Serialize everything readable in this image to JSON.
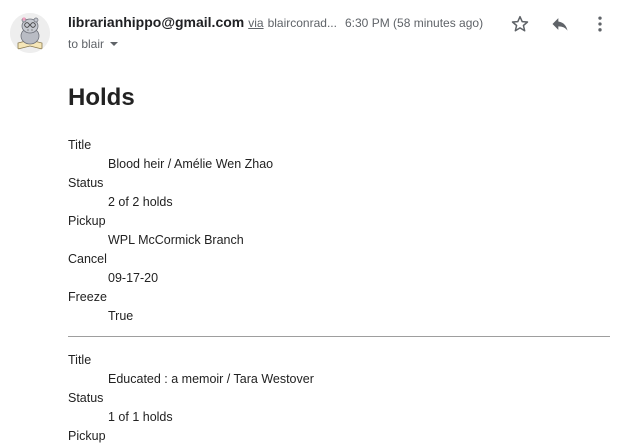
{
  "header": {
    "sender_email": "librarianhippo@gmail.com",
    "via_label": "via",
    "via_address": "blairconrad...",
    "time": "6:30 PM (58 minutes ago)",
    "to_text": "to blair"
  },
  "icons": {
    "avatar": "hippo-avatar",
    "star": "star-icon",
    "reply": "reply-icon",
    "more": "more-vert-icon",
    "caret": "caret-down-icon"
  },
  "page_title": "Holds",
  "holds": [
    {
      "title_label": "Title",
      "title_value": "Blood heir / Amélie Wen Zhao",
      "status_label": "Status",
      "status_value": "2 of 2 holds",
      "pickup_label": "Pickup",
      "pickup_value": "WPL McCormick Branch",
      "cancel_label": "Cancel",
      "cancel_value": "09-17-20",
      "freeze_label": "Freeze",
      "freeze_value": "True"
    },
    {
      "title_label": "Title",
      "title_value": "Educated : a memoir / Tara Westover",
      "status_label": "Status",
      "status_value": "1 of 1 holds",
      "pickup_label": "Pickup"
    }
  ]
}
